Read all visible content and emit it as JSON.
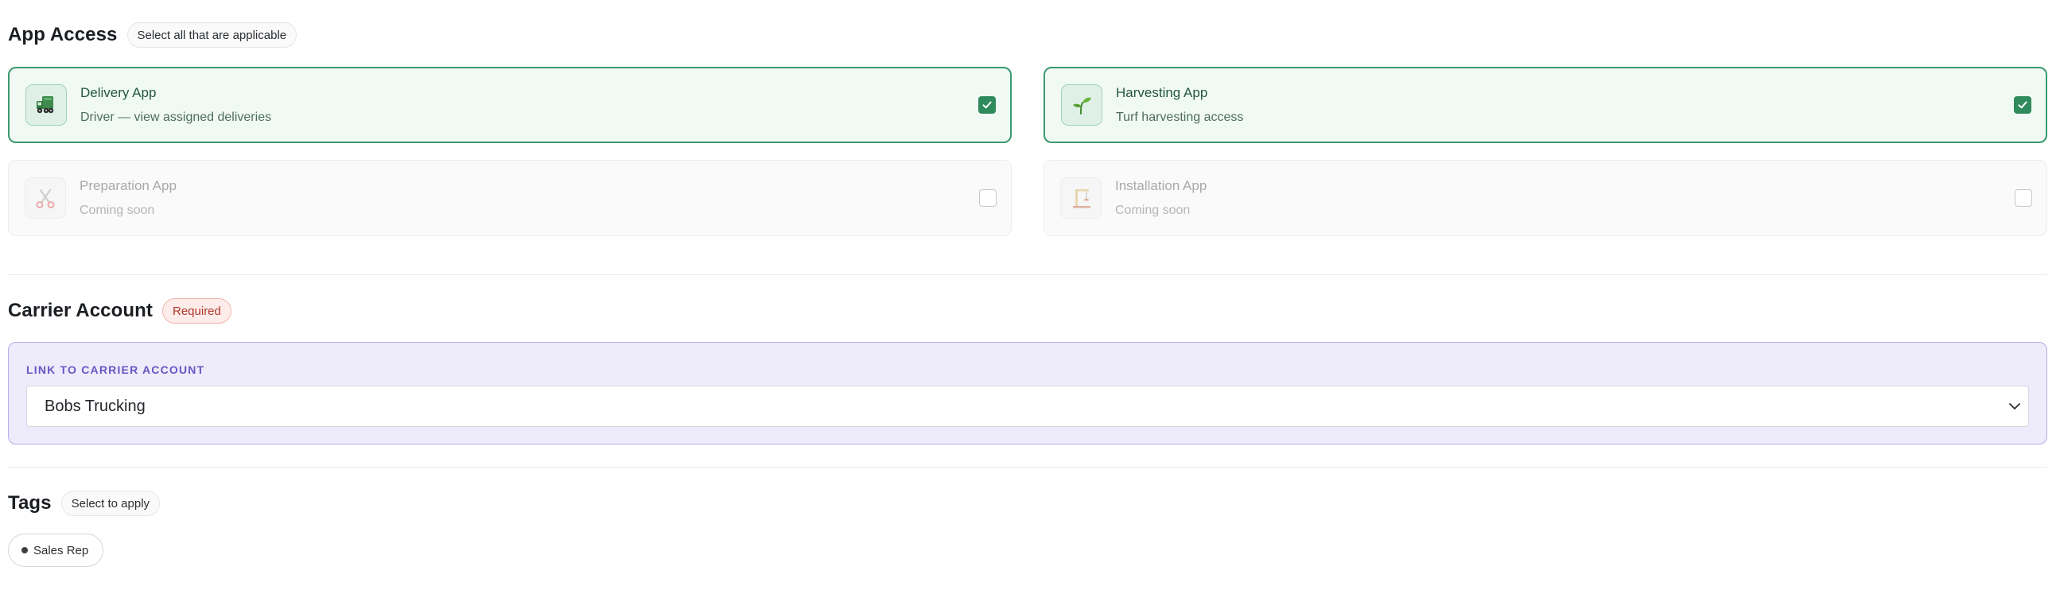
{
  "app_access": {
    "title": "App Access",
    "hint": "Select all that are applicable",
    "apps": [
      {
        "title": "Delivery App",
        "subtitle": "Driver — view assigned deliveries",
        "checked": true,
        "icon": "delivery-truck-icon"
      },
      {
        "title": "Harvesting App",
        "subtitle": "Turf harvesting access",
        "checked": true,
        "icon": "seedling-icon"
      },
      {
        "title": "Preparation App",
        "subtitle": "Coming soon",
        "checked": false,
        "icon": "scissors-icon"
      },
      {
        "title": "Installation App",
        "subtitle": "Coming soon",
        "checked": false,
        "icon": "crane-icon"
      }
    ]
  },
  "carrier": {
    "title": "Carrier Account",
    "badge": "Required",
    "field_label": "LINK TO CARRIER ACCOUNT",
    "selected_value": "Bobs Trucking"
  },
  "tags": {
    "title": "Tags",
    "hint": "Select to apply",
    "items": [
      {
        "label": "Sales Rep"
      }
    ]
  },
  "colors": {
    "accent_green": "#2f8a5c",
    "card_selected_bg": "#f1f9f5",
    "carrier_bg": "#eeebfb",
    "carrier_border": "#b7ace9",
    "required_red": "#b3382b"
  }
}
